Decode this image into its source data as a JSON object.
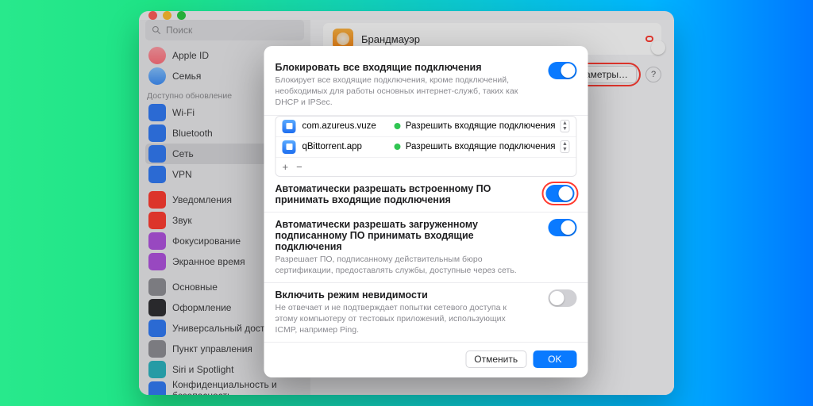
{
  "window": {
    "back_icon": "‹",
    "fwd_icon": "›",
    "title": "Брандмауэр"
  },
  "sidebar": {
    "search_placeholder": "Поиск",
    "apple_id": "Apple ID",
    "family": "Семья",
    "update_label": "Доступно обновление",
    "items": [
      {
        "label": "Wi-Fi",
        "cls": "sb-blue"
      },
      {
        "label": "Bluetooth",
        "cls": "sb-blue"
      },
      {
        "label": "Сеть",
        "cls": "sb-blue",
        "selected": true
      },
      {
        "label": "VPN",
        "cls": "sb-blue"
      },
      {
        "label": "Уведомления",
        "cls": "sb-red"
      },
      {
        "label": "Звук",
        "cls": "sb-red"
      },
      {
        "label": "Фокусирование",
        "cls": "sb-purple"
      },
      {
        "label": "Экранное время",
        "cls": "sb-purple"
      },
      {
        "label": "Основные",
        "cls": "sb-gray"
      },
      {
        "label": "Оформление",
        "cls": "sb-dark"
      },
      {
        "label": "Универсальный доступ",
        "cls": "sb-blue"
      },
      {
        "label": "Пункт управления",
        "cls": "sb-gray"
      },
      {
        "label": "Siri и Spotlight",
        "cls": "sb-teal"
      },
      {
        "label": "Конфиденциальность и безопасность",
        "cls": "sb-blue"
      }
    ]
  },
  "content": {
    "firewall_label": "Брандмауэр",
    "params_btn": "Параметры…",
    "help": "?"
  },
  "sheet": {
    "block_all_title": "Блокировать все входящие подключения",
    "block_all_desc": "Блокирует все входящие подключения, кроме подключений, необходимых для работы основных интернет-служб, таких как DHCP и IPSec.",
    "apps": [
      {
        "name": "com.azureus.vuze",
        "action": "Разрешить входящие подключения"
      },
      {
        "name": "qBittorrent.app",
        "action": "Разрешить входящие подключения"
      }
    ],
    "add": "+",
    "remove": "−",
    "auto_builtin_title": "Автоматически разрешать встроенному ПО принимать входящие подключения",
    "auto_signed_title": "Автоматически разрешать загруженному подписанному ПО принимать входящие подключения",
    "auto_signed_desc": "Разрешает ПО, подписанному действительным бюро сертификации, предоставлять службы, доступные через сеть.",
    "stealth_title": "Включить режим невидимости",
    "stealth_desc": "Не отвечает и не подтверждает попытки сетевого доступа к этому компьютеру от тестовых приложений, использующих ICMP, например Ping.",
    "cancel": "Отменить",
    "ok": "OK"
  }
}
